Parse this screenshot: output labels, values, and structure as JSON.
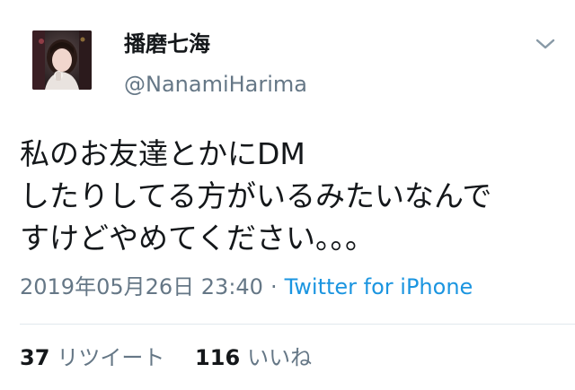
{
  "tweet": {
    "display_name": "播磨七海",
    "handle": "@NanamiHarima",
    "text_lines": [
      "私のお友達とかにDM",
      "したりしてる方がいるみたいなんで",
      "すけどやめてください。。。"
    ],
    "timestamp": "2019年05月26日 23:40",
    "separator": "·",
    "source": "Twitter for iPhone",
    "retweets": {
      "count": "37",
      "label": "リツイート"
    },
    "likes": {
      "count": "116",
      "label": "いいね"
    }
  },
  "icons": {
    "menu": "chevron-down-icon",
    "avatar": "profile-photo"
  },
  "colors": {
    "text": "#14171a",
    "secondary": "#657786",
    "link": "#1b95e0",
    "divider": "#e1e8ed"
  }
}
